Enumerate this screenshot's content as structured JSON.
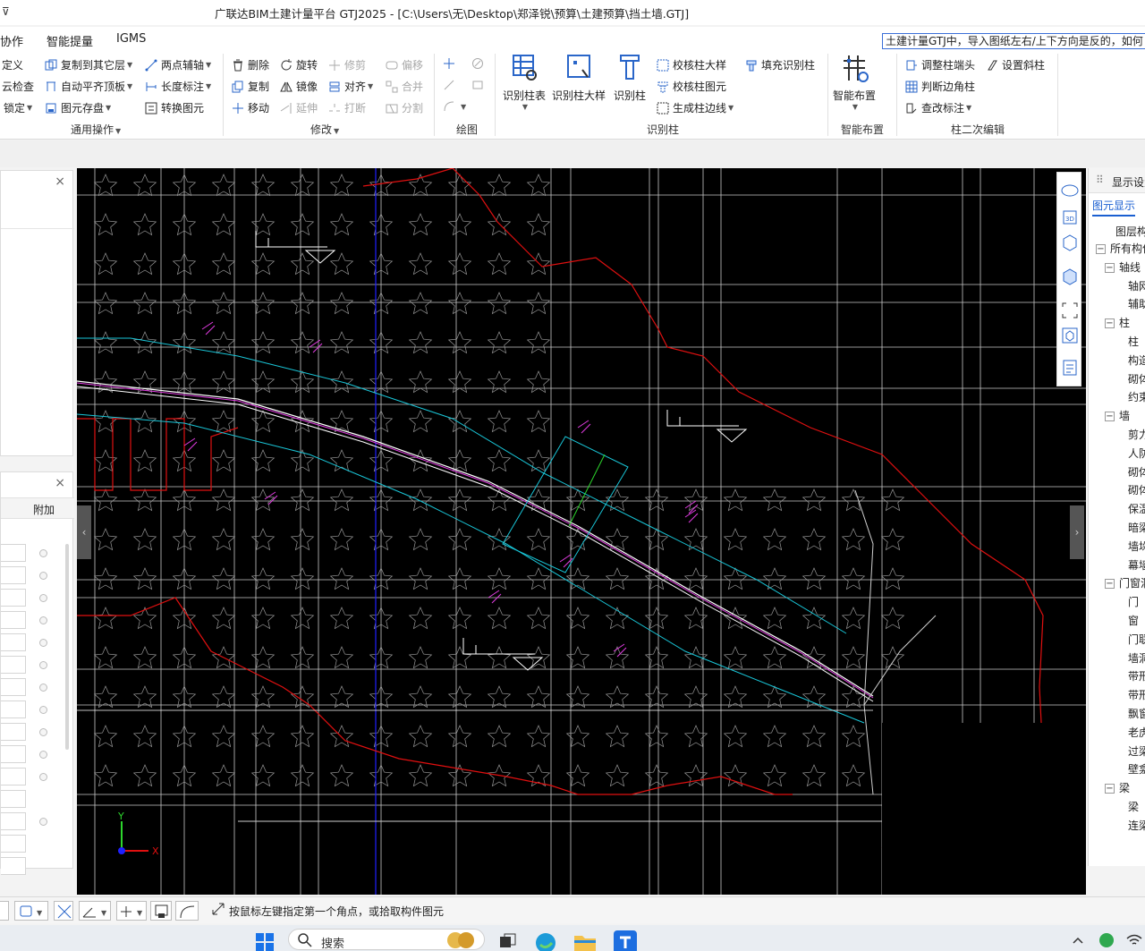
{
  "titlebar": {
    "quick_access": "⊽",
    "title": "广联达BIM土建计量平台 GTJ2025 - [C:\\Users\\无\\Desktop\\郑泽锐\\预算\\土建预算\\挡土墙.GTJ]"
  },
  "menu": {
    "tabs": [
      "协作",
      "智能提量",
      "IGMS"
    ],
    "tip": "土建计量GTJ中，导入图纸左右/上下方向是反的，如何"
  },
  "ribbon": {
    "general": {
      "items": [
        "定义",
        "云检查",
        "锁定",
        "复制到其它层",
        "自动平齐顶板",
        "图元存盘",
        "两点辅轴",
        "长度标注",
        "转换图元"
      ],
      "label": "通用操作"
    },
    "modify": {
      "items": [
        "删除",
        "复制",
        "移动",
        "旋转",
        "镜像",
        "延伸",
        "修剪",
        "对齐",
        "打断",
        "偏移",
        "合并",
        "分割"
      ],
      "label": "修改"
    },
    "draw": {
      "label": "绘图"
    },
    "recognize": {
      "big": [
        "识别柱表",
        "识别柱大样",
        "识别柱"
      ],
      "items": [
        "校核柱大样",
        "校核柱图元",
        "生成柱边线",
        "填充识别柱"
      ],
      "label": "识别柱"
    },
    "smart": {
      "big": "智能布置",
      "label": "智能布置"
    },
    "secondary": {
      "items": [
        "调整柱端头",
        "判断边角柱",
        "查改标注",
        "设置斜柱"
      ],
      "label": "柱二次编辑"
    }
  },
  "left_panel": {
    "header": "附加",
    "close": "×"
  },
  "right_panel": {
    "header": "显示设置",
    "tab": "图元显示",
    "col": "图层构件",
    "tree": [
      {
        "label": "所有构件",
        "level": 0,
        "box": "−"
      },
      {
        "label": "轴线",
        "level": 1,
        "box": "−"
      },
      {
        "label": "轴网",
        "level": 2
      },
      {
        "label": "辅助轴线",
        "level": 2
      },
      {
        "label": "柱",
        "level": 1,
        "box": "−"
      },
      {
        "label": "柱",
        "level": 2
      },
      {
        "label": "构造柱",
        "level": 2
      },
      {
        "label": "砌体柱",
        "level": 2
      },
      {
        "label": "约束边缘",
        "level": 2
      },
      {
        "label": "墙",
        "level": 1,
        "box": "−"
      },
      {
        "label": "剪力墙",
        "level": 2
      },
      {
        "label": "人防门框墙",
        "level": 2
      },
      {
        "label": "砌体墙",
        "level": 2
      },
      {
        "label": "砌体加筋",
        "level": 2
      },
      {
        "label": "保温墙",
        "level": 2
      },
      {
        "label": "暗梁",
        "level": 2
      },
      {
        "label": "墙垛",
        "level": 2
      },
      {
        "label": "幕墙",
        "level": 2
      },
      {
        "label": "门窗洞",
        "level": 1,
        "box": "−"
      },
      {
        "label": "门",
        "level": 2
      },
      {
        "label": "窗",
        "level": 2
      },
      {
        "label": "门联窗",
        "level": 2
      },
      {
        "label": "墙洞",
        "level": 2
      },
      {
        "label": "带形窗",
        "level": 2
      },
      {
        "label": "带形洞",
        "level": 2
      },
      {
        "label": "飘窗",
        "level": 2
      },
      {
        "label": "老虎窗",
        "level": 2
      },
      {
        "label": "过梁",
        "level": 2
      },
      {
        "label": "壁龛",
        "level": 2
      },
      {
        "label": "梁",
        "level": 1,
        "box": "−"
      },
      {
        "label": "梁",
        "level": 2
      },
      {
        "label": "连梁",
        "level": 2
      }
    ]
  },
  "status": {
    "message": "按鼠标左键指定第一个角点，或拾取构件图元"
  },
  "taskbar": {
    "search": "搜索"
  },
  "colors": {
    "canvas_bg": "#000000",
    "grid": "#c8c8c8",
    "contour": "#e01010",
    "cyan": "#19c6d8",
    "magenta": "#e23ce2",
    "axis_blue": "#2020ff"
  }
}
